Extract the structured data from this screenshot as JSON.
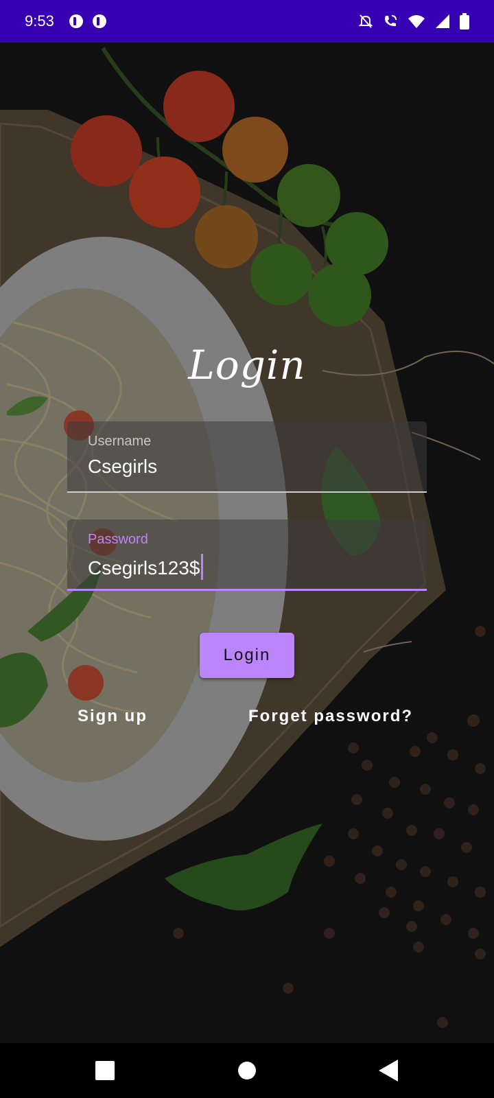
{
  "status_bar": {
    "time": "9:53",
    "icons": [
      "app-notification-icon",
      "app-notification-icon",
      "do-not-disturb-icon",
      "wifi-calling-icon",
      "wifi-icon",
      "signal-icon",
      "battery-icon"
    ],
    "background": "#3700b3"
  },
  "login": {
    "title": "Login",
    "username": {
      "label": "Username",
      "value": "Csegirls"
    },
    "password": {
      "label": "Password",
      "value": "Csegirls123$"
    },
    "button_label": "Login",
    "signup_label": "Sign up",
    "forgot_label": "Forget password?",
    "accent": "#bb86fc"
  },
  "nav_bar": {
    "buttons": [
      "recents-square-icon",
      "home-circle-icon",
      "back-triangle-icon"
    ]
  }
}
